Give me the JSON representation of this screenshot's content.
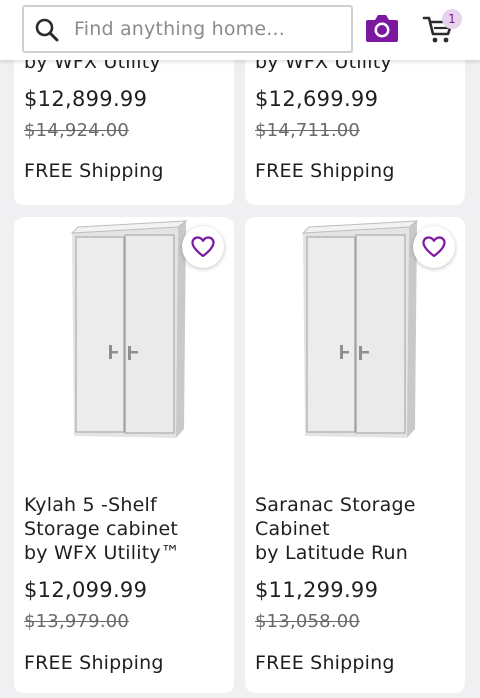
{
  "header": {
    "search_placeholder": "Find anything home...",
    "cart_count": "1",
    "accent_color": "#7b189f",
    "icons": [
      "search-icon",
      "camera-icon",
      "cart-icon"
    ]
  },
  "products": [
    {
      "brand": "by WFX Utility™",
      "price": "$12,899.99",
      "old_price": "$14,924.00",
      "shipping": "FREE Shipping"
    },
    {
      "brand": "by WFX Utility™",
      "price": "$12,699.99",
      "old_price": "$14,711.00",
      "shipping": "FREE Shipping"
    },
    {
      "title_line1": "Kylah 5 -Shelf",
      "title_line2": "Storage cabinet",
      "brand": "by WFX Utility™",
      "price": "$12,099.99",
      "old_price": "$13,979.00",
      "shipping": "FREE Shipping"
    },
    {
      "title_line1": "Saranac Storage",
      "title_line2": "Cabinet",
      "brand": "by Latitude Run",
      "price": "$11,299.99",
      "old_price": "$13,058.00",
      "shipping": "FREE Shipping"
    }
  ]
}
